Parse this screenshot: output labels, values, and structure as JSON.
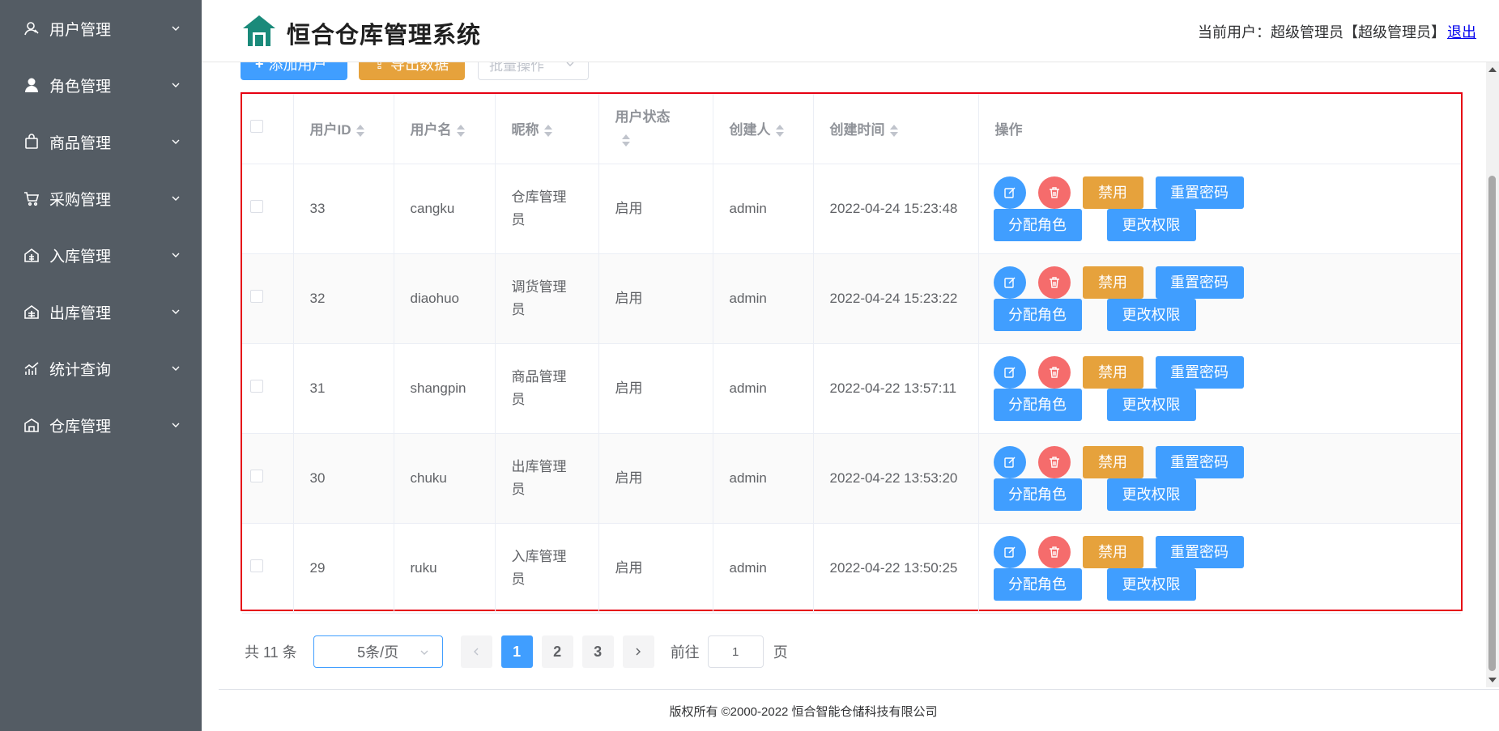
{
  "sidebar": {
    "items": [
      {
        "label": "用户管理",
        "icon": "user-icon"
      },
      {
        "label": "角色管理",
        "icon": "role-icon"
      },
      {
        "label": "商品管理",
        "icon": "goods-bag-icon"
      },
      {
        "label": "采购管理",
        "icon": "cart-icon"
      },
      {
        "label": "入库管理",
        "icon": "inbound-icon"
      },
      {
        "label": "出库管理",
        "icon": "outbound-icon"
      },
      {
        "label": "统计查询",
        "icon": "stats-icon"
      },
      {
        "label": "仓库管理",
        "icon": "warehouse-icon"
      }
    ]
  },
  "header": {
    "title": "恒合仓库管理系统",
    "user_info": "当前用户：超级管理员【超级管理员】",
    "logout": "退出",
    "logo_color": "#1a8a7a"
  },
  "toolbar": {
    "add_label": "添加用户",
    "export_label": "导出数据",
    "batch_placeholder": "批量操作"
  },
  "table": {
    "headers": {
      "user_id": "用户ID",
      "username": "用户名",
      "nickname": "昵称",
      "status": "用户状态",
      "creator": "创建人",
      "created_at": "创建时间",
      "actions": "操作"
    },
    "rows": [
      {
        "id": "33",
        "username": "cangku",
        "nickname": "仓库管理员",
        "status": "启用",
        "creator": "admin",
        "created_at": "2022-04-24 15:23:48"
      },
      {
        "id": "32",
        "username": "diaohuo",
        "nickname": "调货管理员",
        "status": "启用",
        "creator": "admin",
        "created_at": "2022-04-24 15:23:22"
      },
      {
        "id": "31",
        "username": "shangpin",
        "nickname": "商品管理员",
        "status": "启用",
        "creator": "admin",
        "created_at": "2022-04-22 13:57:11"
      },
      {
        "id": "30",
        "username": "chuku",
        "nickname": "出库管理员",
        "status": "启用",
        "creator": "admin",
        "created_at": "2022-04-22 13:53:20"
      },
      {
        "id": "29",
        "username": "ruku",
        "nickname": "入库管理员",
        "status": "启用",
        "creator": "admin",
        "created_at": "2022-04-22 13:50:25"
      }
    ],
    "actions": {
      "disable": "禁用",
      "reset_password": "重置密码",
      "assign_role": "分配角色",
      "change_permission": "更改权限"
    }
  },
  "pagination": {
    "total": "共 11 条",
    "page_size": "5条/页",
    "pages": [
      "1",
      "2",
      "3"
    ],
    "current_page": "1",
    "goto_label": "前往",
    "goto_value": "1",
    "page_suffix": "页"
  },
  "footer": {
    "copyright": "版权所有 ©2000-2022  恒合智能仓储科技有限公司"
  },
  "colors": {
    "primary": "#409eff",
    "warning": "#e6a23c",
    "danger": "#f56c6c",
    "sidebar_bg": "#545c64",
    "highlight_border": "#e60012"
  }
}
